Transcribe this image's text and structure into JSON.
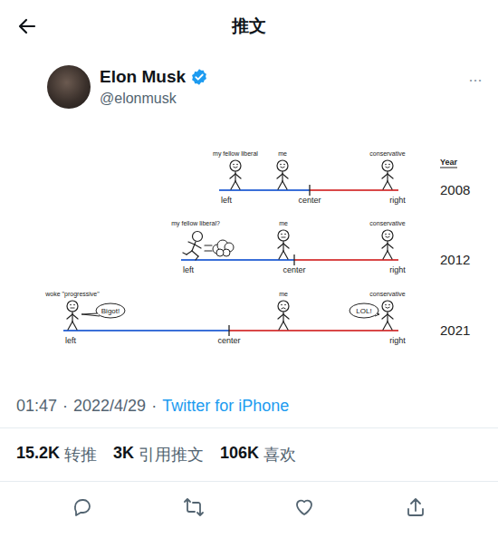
{
  "header": {
    "title": "推文"
  },
  "tweet": {
    "name": "Elon Musk",
    "handle": "@elonmusk",
    "verified": true,
    "more": "···"
  },
  "chart": {
    "year_label": "Year",
    "rows": [
      {
        "year": "2008",
        "axis": {
          "left": "left",
          "center": "center",
          "right": "right"
        },
        "figures": [
          {
            "label": "my fellow liberal",
            "kind": "smiling"
          },
          {
            "label": "me",
            "kind": "smiling"
          },
          {
            "label": "conservative",
            "kind": "smiling"
          }
        ]
      },
      {
        "year": "2012",
        "axis": {
          "left": "left",
          "center": "center",
          "right": "right"
        },
        "figures": [
          {
            "label": "my fellow liberal?",
            "kind": "running"
          },
          {
            "label": "me",
            "kind": "neutral"
          },
          {
            "label": "conservative",
            "kind": "smiling"
          }
        ]
      },
      {
        "year": "2021",
        "axis": {
          "left": "left",
          "center": "center",
          "right": "right"
        },
        "figures": [
          {
            "label": "woke \"progressive\"",
            "kind": "neutral",
            "bubble": "Bigot!"
          },
          {
            "label": "me",
            "kind": "frowning"
          },
          {
            "label": "conservative",
            "kind": "smiling",
            "bubble": "LOL!"
          }
        ]
      }
    ]
  },
  "meta": {
    "parts": [
      "01:47",
      "·",
      "2022/4/29",
      "·"
    ],
    "source": "Twitter for iPhone"
  },
  "stats": [
    {
      "count": "15.2K",
      "label": "转推"
    },
    {
      "count": "3K",
      "label": "引用推文"
    },
    {
      "count": "106K",
      "label": "喜欢"
    }
  ]
}
